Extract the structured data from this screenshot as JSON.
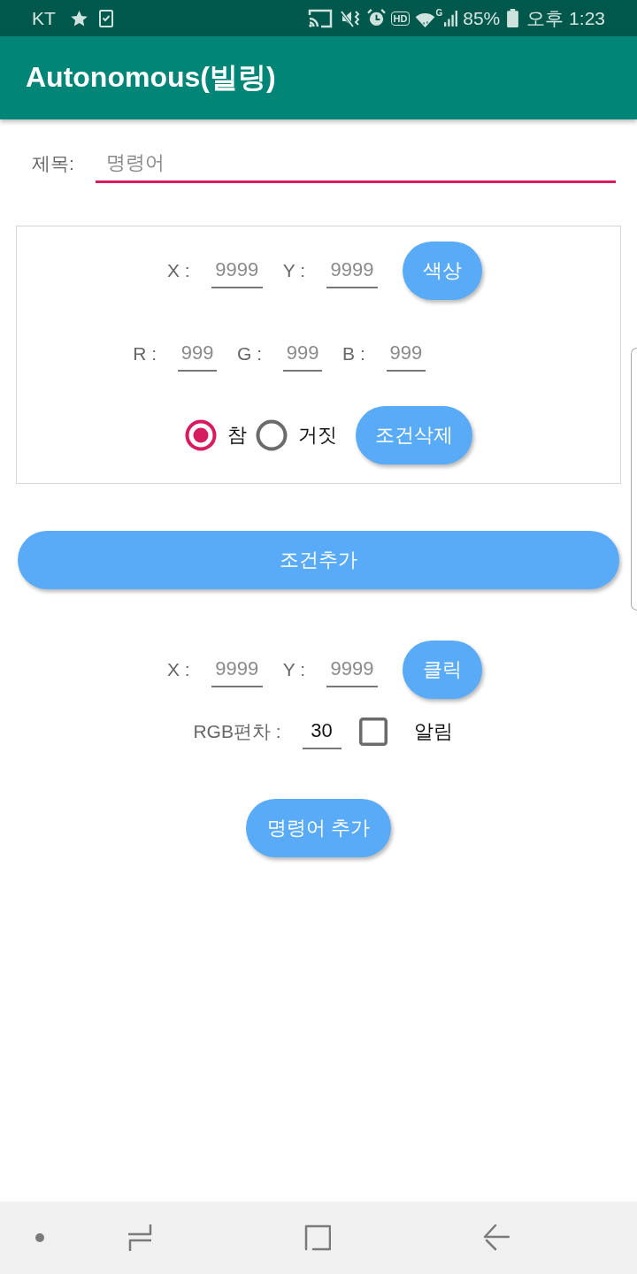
{
  "status_bar": {
    "carrier": "KT",
    "hd_badge": "HD",
    "network_type": "G",
    "battery": "85%",
    "time": "오후 1:23"
  },
  "app_bar": {
    "title": "Autonomous(빌링)"
  },
  "title_field": {
    "label": "제목:",
    "placeholder": "명령어",
    "focused": true
  },
  "condition_card": {
    "position_fields": [
      {
        "label": "X :",
        "placeholder": "9999"
      },
      {
        "label": "Y :",
        "placeholder": "9999"
      }
    ],
    "color_button": "색상",
    "rgb_fields": [
      {
        "label": "R :",
        "placeholder": "999"
      },
      {
        "label": "G :",
        "placeholder": "999"
      },
      {
        "label": "B :",
        "placeholder": "999"
      }
    ],
    "radios": [
      {
        "label": "참",
        "selected": true
      },
      {
        "label": "거짓",
        "selected": false
      }
    ],
    "delete_button": "조건삭제"
  },
  "add_condition_button": "조건추가",
  "click_fields": [
    {
      "label": "X :",
      "placeholder": "9999"
    },
    {
      "label": "Y :",
      "placeholder": "9999"
    }
  ],
  "click_button": "클릭",
  "deviation_field": {
    "label": "RGB편차 :",
    "value": "30"
  },
  "alert_checkbox": {
    "label": "알림",
    "checked": false
  },
  "add_command_button": "명령어 추가"
}
